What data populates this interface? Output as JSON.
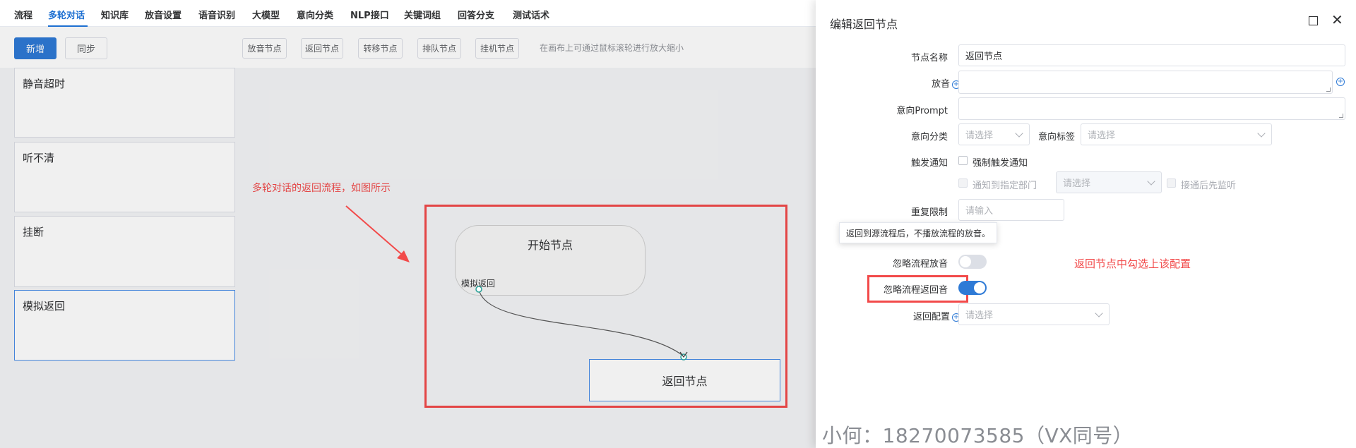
{
  "nav": {
    "tabs": [
      {
        "label": "流程"
      },
      {
        "label": "多轮对话"
      },
      {
        "label": "知识库"
      },
      {
        "label": "放音设置"
      },
      {
        "label": "语音识别"
      },
      {
        "label": "大模型"
      },
      {
        "label": "意向分类"
      },
      {
        "label": "NLP接口"
      },
      {
        "label": "关键词组"
      },
      {
        "label": "回答分支"
      },
      {
        "label": "测试话术"
      }
    ],
    "active_tab": "多轮对话"
  },
  "toolbar": {
    "add_label": "新增",
    "sync_label": "同步",
    "node_buttons": [
      "放音节点",
      "返回节点",
      "转移节点",
      "排队节点",
      "挂机节点"
    ],
    "hint": "在画布上可通过鼠标滚轮进行放大缩小"
  },
  "left_list": {
    "items": [
      {
        "label": "静音超时"
      },
      {
        "label": "听不清"
      },
      {
        "label": "挂断"
      },
      {
        "label": "模拟返回"
      }
    ],
    "selected": "模拟返回"
  },
  "canvas": {
    "annotation": "多轮对话的返回流程，如图所示",
    "start_node": {
      "title": "开始节点",
      "port_label": "模拟返回"
    },
    "return_node": {
      "title": "返回节点"
    }
  },
  "drawer": {
    "title": "编辑返回节点",
    "fields": {
      "node_name": {
        "label": "节点名称",
        "value": "返回节点"
      },
      "playback": {
        "label": "放音",
        "value": ""
      },
      "intent_prompt": {
        "label": "意向Prompt",
        "value": ""
      },
      "intent_category": {
        "label": "意向分类",
        "placeholder": "请选择"
      },
      "intent_tag": {
        "label": "意向标签",
        "placeholder": "请选择"
      },
      "trigger_notify": {
        "label": "触发通知",
        "force_trigger": "强制触发通知",
        "notify_dept": "通知到指定部门",
        "dept_placeholder": "请选择",
        "monitor_first": "接通后先监听"
      },
      "repeat_limit": {
        "label": "重复限制",
        "placeholder": "请输入"
      },
      "ignore_flow_playback": {
        "label": "忽略流程放音",
        "enabled": false
      },
      "ignore_flow_return_audio": {
        "label": "忽略流程返回音",
        "enabled": true
      },
      "return_config": {
        "label": "返回配置",
        "placeholder": "请选择"
      }
    },
    "tooltip": "返回到源流程后，不播放流程的放音。"
  },
  "annotation_right": "返回节点中勾选上该配置",
  "watermark": "小何：18270073585（VX同号）",
  "colors": {
    "accent": "#2e7ad6",
    "annotation_red": "#f24a4a",
    "edge_teal": "#2aa198"
  },
  "icons": [
    "maximize-icon",
    "close-icon",
    "plus-circle-icon",
    "chevron-down-icon"
  ]
}
